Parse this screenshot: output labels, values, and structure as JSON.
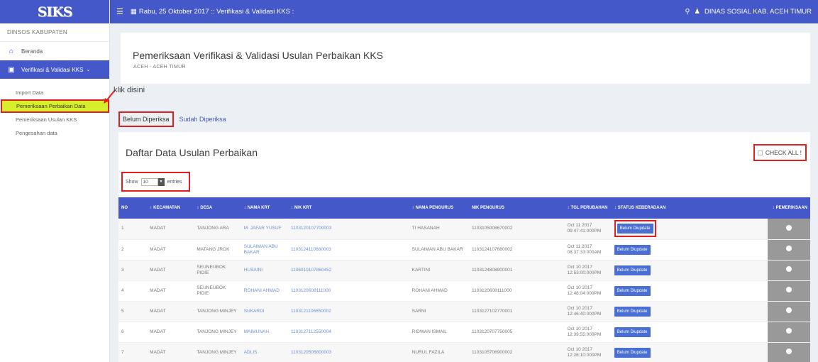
{
  "app": {
    "logo": "SIKS"
  },
  "sidebar": {
    "heading": "DINSOS KABUPATEN",
    "items": [
      {
        "label": "Beranda",
        "icon": "home-icon"
      },
      {
        "label": "Verifikasi & Validasi KKS",
        "icon": "monitor-icon"
      }
    ],
    "subitems": [
      {
        "label": "Import Data"
      },
      {
        "label": "Pemeriksaan Perbaikan Data"
      },
      {
        "label": "Pemeriksaan Usulan KKS"
      },
      {
        "label": "Pengesahan data"
      }
    ]
  },
  "topbar": {
    "date_text": "Rabu, 25 Oktober 2017 :: Verifikasi & Validasi KKS :",
    "user": "DINAS SOSIAL KAB. ACEH TIMUR"
  },
  "page": {
    "title": "Pemeriksaan Verifikasi & Validasi Usulan Perbaikan KKS",
    "subtitle": "ACEH - ACEH TIMUR",
    "annotation": "klik disini"
  },
  "tabs": [
    {
      "label": "Belum Diperiksa"
    },
    {
      "label": "Sudah Diperiksa"
    }
  ],
  "list": {
    "heading": "Daftar Data Usulan Perbaikan",
    "check_all": "CHECK ALL !",
    "show_label": "Show",
    "show_value": "10",
    "entries_label": "entries"
  },
  "table": {
    "columns": [
      "NO",
      "KECAMATAN",
      "DESA",
      "NAMA KRT",
      "NIK KRT",
      "NAMA PENGURUS",
      "NIK PENGURUS",
      "TGL PERUBAHAN",
      "STATUS KEBERADAAN",
      "PEMERIKSAAN"
    ],
    "rows": [
      {
        "no": "1",
        "kec": "MADAT",
        "desa": "TANJONG ARA",
        "krt": "M. JAFAR YUSUF",
        "nik_krt": "1103120107700003",
        "pengurus": "TI HASANAH",
        "nik_pengurus": "1103105008670002",
        "tgl": "Oct 11 2017 09:47:41:000PM",
        "status": "Belum Diupdate"
      },
      {
        "no": "2",
        "kec": "MADAT",
        "desa": "MATANG JROK",
        "krt": "SULAIMAN ABU BAKAR",
        "nik_krt": "1103124110680003",
        "pengurus": "SULAIMAN ABU BAKAR",
        "nik_pengurus": "1103124107680002",
        "tgl": "Oct 11 2017 08:37:33:000AM",
        "status": "Belum Diupdate"
      },
      {
        "no": "3",
        "kec": "MADAT",
        "desa": "SEUNEUBOK PIDIE",
        "krt": "HUSAINI",
        "nik_krt": "1106010107860452",
        "pengurus": "KARTINI",
        "nik_pengurus": "1103124808900001",
        "tgl": "Oct 10 2017 12:53:00:000PM",
        "status": "Belum Diupdate"
      },
      {
        "no": "4",
        "kec": "MADAT",
        "desa": "SEUNEUBOK PIDIE",
        "krt": "ROHANI AHMAD",
        "nik_krt": "1103120608111000",
        "pengurus": "ROHANI AHMAD",
        "nik_pengurus": "1103120608111000",
        "tgl": "Oct 10 2017 12:48:04:000PM",
        "status": "Belum Diupdate"
      },
      {
        "no": "5",
        "kec": "MADAT",
        "desa": "TANJONG MINJEY",
        "krt": "SUKARDI",
        "nik_krt": "1103121106650002",
        "pengurus": "SARNI",
        "nik_pengurus": "1103127102770001",
        "tgl": "Oct 10 2017 12:46:40:000PM",
        "status": "Belum Diupdate"
      },
      {
        "no": "6",
        "kec": "MADAT",
        "desa": "TANJONG MINJEY",
        "krt": "MAIMUNAH",
        "nik_krt": "1103127112550004",
        "pengurus": "RIDWAN ISMAIL",
        "nik_pengurus": "1103120707750005",
        "tgl": "Oct 10 2017 12:39:55:000PM",
        "status": "Belum Diupdate"
      },
      {
        "no": "7",
        "kec": "MADAT",
        "desa": "TANJONG MINJEY",
        "krt": "ADLIS",
        "nik_krt": "1103120506800003",
        "pengurus": "NURUL FAZILA",
        "nik_pengurus": "1103105706900002",
        "tgl": "Oct 10 2017 12:26:10:000PM",
        "status": "Belum Diupdate"
      }
    ]
  },
  "colors": {
    "primary": "#4458c9",
    "highlight": "#d7ee2a",
    "annotation": "#e02020"
  }
}
